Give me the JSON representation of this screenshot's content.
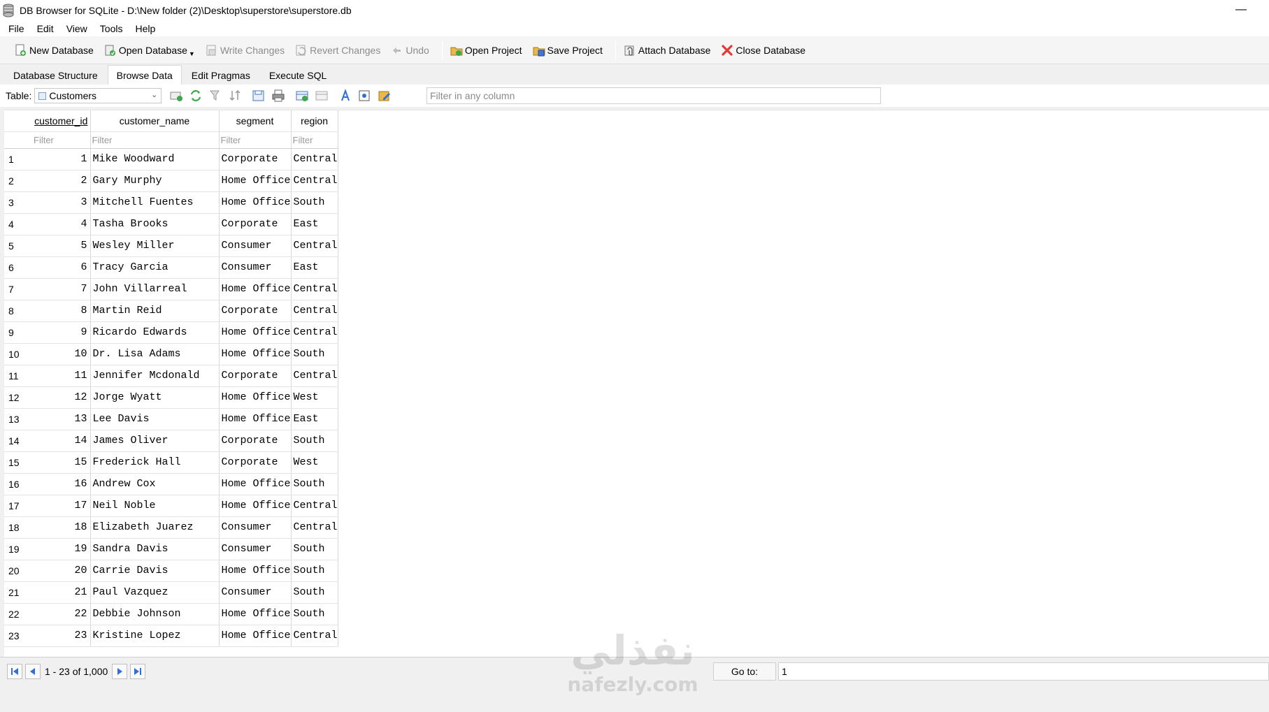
{
  "window": {
    "title": "DB Browser for SQLite - D:\\New folder (2)\\Desktop\\superstore\\superstore.db",
    "minimize_glyph": "—"
  },
  "menu": [
    "File",
    "Edit",
    "View",
    "Tools",
    "Help"
  ],
  "toolbar": {
    "new_database": "New Database",
    "open_database": "Open Database",
    "write_changes": "Write Changes",
    "revert_changes": "Revert Changes",
    "undo": "Undo",
    "open_project": "Open Project",
    "save_project": "Save Project",
    "attach_database": "Attach Database",
    "close_database": "Close Database"
  },
  "tabs": [
    {
      "label": "Database Structure",
      "active": false
    },
    {
      "label": "Browse Data",
      "active": true
    },
    {
      "label": "Edit Pragmas",
      "active": false
    },
    {
      "label": "Execute SQL",
      "active": false
    }
  ],
  "browse": {
    "table_label": "Table:",
    "table_selected": "Customers",
    "filter_placeholder": "Filter in any column"
  },
  "grid": {
    "columns": [
      "customer_id",
      "customer_name",
      "segment",
      "region"
    ],
    "filter_placeholder": "Filter",
    "rows": [
      [
        "1",
        "1",
        "Mike Woodward",
        "Corporate",
        "Central"
      ],
      [
        "2",
        "2",
        "Gary Murphy",
        "Home Office",
        "Central"
      ],
      [
        "3",
        "3",
        "Mitchell Fuentes",
        "Home Office",
        "South"
      ],
      [
        "4",
        "4",
        "Tasha Brooks",
        "Corporate",
        "East"
      ],
      [
        "5",
        "5",
        "Wesley Miller",
        "Consumer",
        "Central"
      ],
      [
        "6",
        "6",
        "Tracy Garcia",
        "Consumer",
        "East"
      ],
      [
        "7",
        "7",
        "John Villarreal",
        "Home Office",
        "Central"
      ],
      [
        "8",
        "8",
        "Martin Reid",
        "Corporate",
        "Central"
      ],
      [
        "9",
        "9",
        "Ricardo Edwards",
        "Home Office",
        "Central"
      ],
      [
        "10",
        "10",
        "Dr. Lisa Adams",
        "Home Office",
        "South"
      ],
      [
        "11",
        "11",
        "Jennifer Mcdonald",
        "Corporate",
        "Central"
      ],
      [
        "12",
        "12",
        "Jorge Wyatt",
        "Home Office",
        "West"
      ],
      [
        "13",
        "13",
        "Lee Davis",
        "Home Office",
        "East"
      ],
      [
        "14",
        "14",
        "James Oliver",
        "Corporate",
        "South"
      ],
      [
        "15",
        "15",
        "Frederick Hall",
        "Corporate",
        "West"
      ],
      [
        "16",
        "16",
        "Andrew Cox",
        "Home Office",
        "South"
      ],
      [
        "17",
        "17",
        "Neil Noble",
        "Home Office",
        "Central"
      ],
      [
        "18",
        "18",
        "Elizabeth Juarez",
        "Consumer",
        "Central"
      ],
      [
        "19",
        "19",
        "Sandra Davis",
        "Consumer",
        "South"
      ],
      [
        "20",
        "20",
        "Carrie Davis",
        "Home Office",
        "South"
      ],
      [
        "21",
        "21",
        "Paul Vazquez",
        "Consumer",
        "South"
      ],
      [
        "22",
        "22",
        "Debbie Johnson",
        "Home Office",
        "South"
      ],
      [
        "23",
        "23",
        "Kristine Lopez",
        "Home Office",
        "Central"
      ]
    ]
  },
  "navigation": {
    "record_range": "1 - 23 of 1,000",
    "goto_label": "Go to:",
    "goto_value": "1"
  },
  "watermark": {
    "logo_text": "نفذلي",
    "url": "nafezly.com"
  },
  "colors": {
    "accent_blue": "#2f6fd6",
    "close_red": "#e53935",
    "folder_yellow": "#e8b84a"
  }
}
